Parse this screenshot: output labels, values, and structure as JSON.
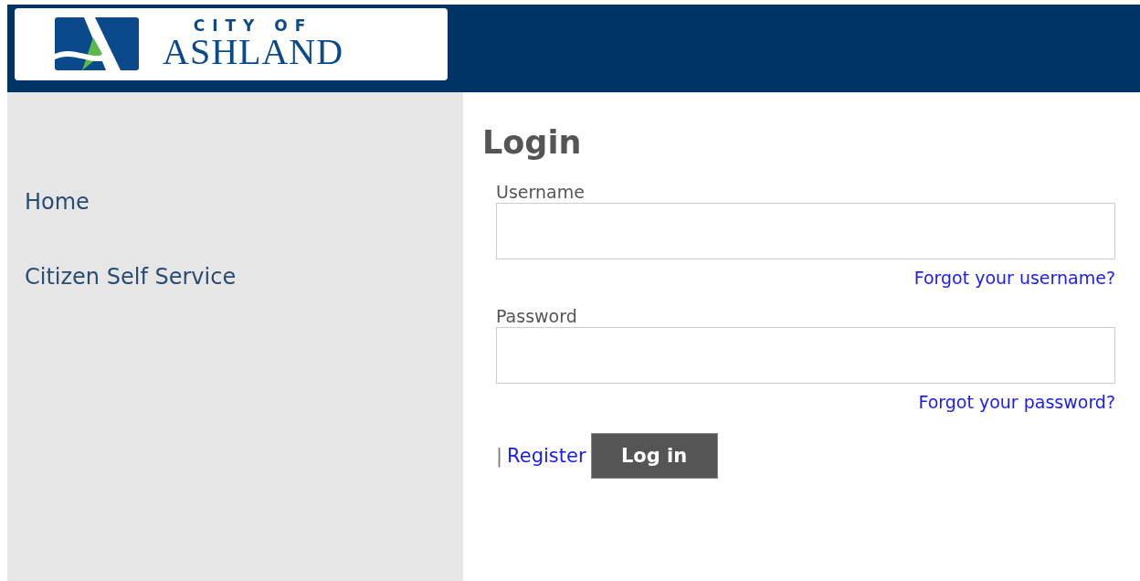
{
  "logo": {
    "line_1": "CITY OF",
    "line_2": "ASHLAND"
  },
  "sidebar": {
    "items": [
      {
        "label": "Home"
      },
      {
        "label": "Citizen Self Service"
      }
    ]
  },
  "login": {
    "title": "Login",
    "fields": [
      {
        "label": "Username",
        "help_link": "Forgot your username?"
      },
      {
        "label": "Password",
        "help_link": "Forgot your password?"
      }
    ],
    "separator": "|",
    "register_link": "Register",
    "submit": "Log in"
  }
}
